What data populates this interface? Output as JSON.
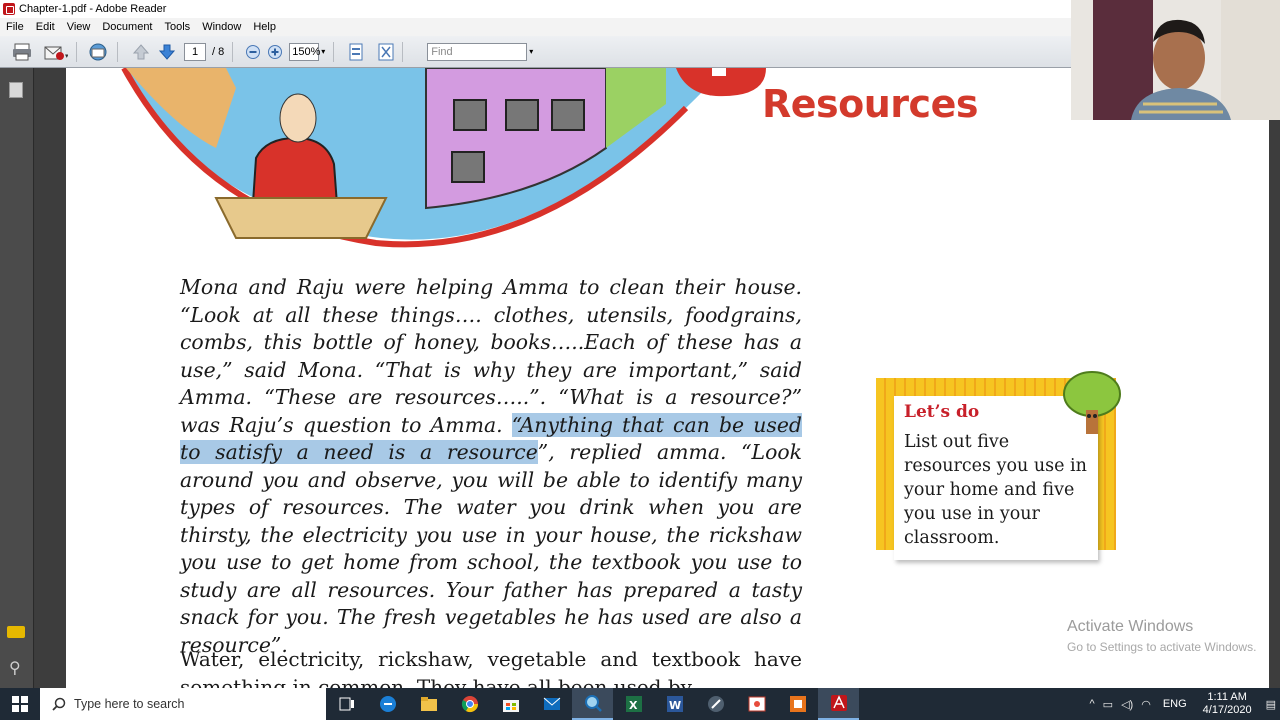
{
  "window": {
    "title": "Chapter-1.pdf - Adobe Reader"
  },
  "menu": [
    "File",
    "Edit",
    "View",
    "Document",
    "Tools",
    "Window",
    "Help"
  ],
  "toolbar": {
    "current_page": "1",
    "total_pages": "/ 8",
    "zoom": "150%",
    "find_placeholder": "Find"
  },
  "document": {
    "heading": "Resources",
    "story_part1": "Mona and Raju were helping Amma to clean their house. “Look at all these things…. clothes, utensils, foodgrains, combs, this bottle of honey, books…..Each of these has a use,” said Mona. “That is why they are important,” said Amma. “These are resources…..”. “What is a resource?” was Raju’s question to Amma. ",
    "story_highlight": "“Anything that can be used to satisfy a need is a resource",
    "story_part2": "”, replied amma. “Look around you and observe, you will be able to identify many types of resources. The water you drink when you are thirsty, the electricity you use in your house, the rickshaw you use to get home from school, the textbook you use to study are all resources. Your father has prepared a tasty snack for you. The fresh vegetables he has used are also a resource”.",
    "para2": "Water, electricity, rickshaw, vegetable and textbook have something in common. They have all been used by",
    "lets_do": {
      "title": "Let’s do",
      "body": "List out five resources you use in your home and five you use in your classroom."
    }
  },
  "overlay": {
    "activate_title": "Activate Windows",
    "activate_sub": "Go to Settings to activate Windows."
  },
  "taskbar": {
    "search_placeholder": "Type here to search",
    "lang": "ENG",
    "time": "1:11 AM",
    "date": "4/17/2020"
  },
  "colors": {
    "heading": "#d33a2c",
    "highlight": "#a8c9e6",
    "lets_do_title": "#c8202a",
    "taskbar": "#1f2a36"
  }
}
